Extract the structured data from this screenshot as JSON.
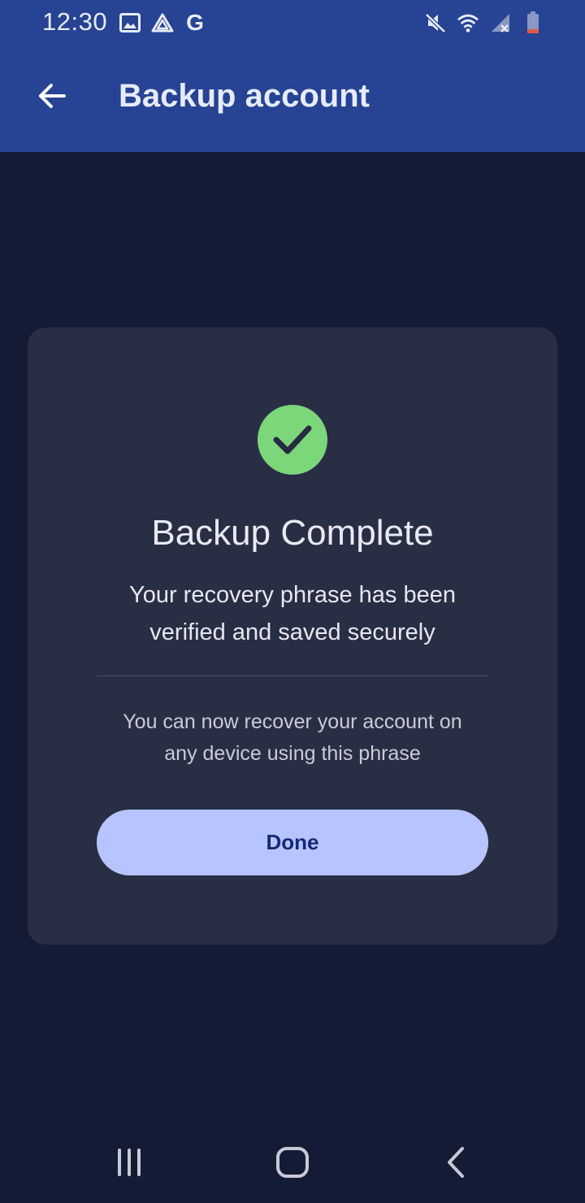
{
  "status_bar": {
    "time": "12:30",
    "left_icons": [
      "gallery-icon",
      "drive-icon",
      "google-g-icon"
    ],
    "google_letter": "G",
    "right_icons": [
      "mute-icon",
      "wifi-icon",
      "signal-icon",
      "battery-low-icon"
    ]
  },
  "app_bar": {
    "title": "Backup account",
    "back_icon": "arrow-left-icon"
  },
  "card": {
    "icon": "check-circle-icon",
    "title": "Backup Complete",
    "message_line1": "Your recovery phrase has been",
    "message_line2": "verified and saved securely",
    "note_line1": "You can now recover your account on",
    "note_line2": "any device using this phrase",
    "button_label": "Done"
  },
  "nav_bar": {
    "items": [
      "recents-icon",
      "home-icon",
      "back-icon"
    ]
  },
  "colors": {
    "app_bar": "#264394",
    "background": "#141b34",
    "card": "#282e44",
    "success": "#7cd67a",
    "button": "#b8c4ff",
    "button_text": "#142a78"
  }
}
